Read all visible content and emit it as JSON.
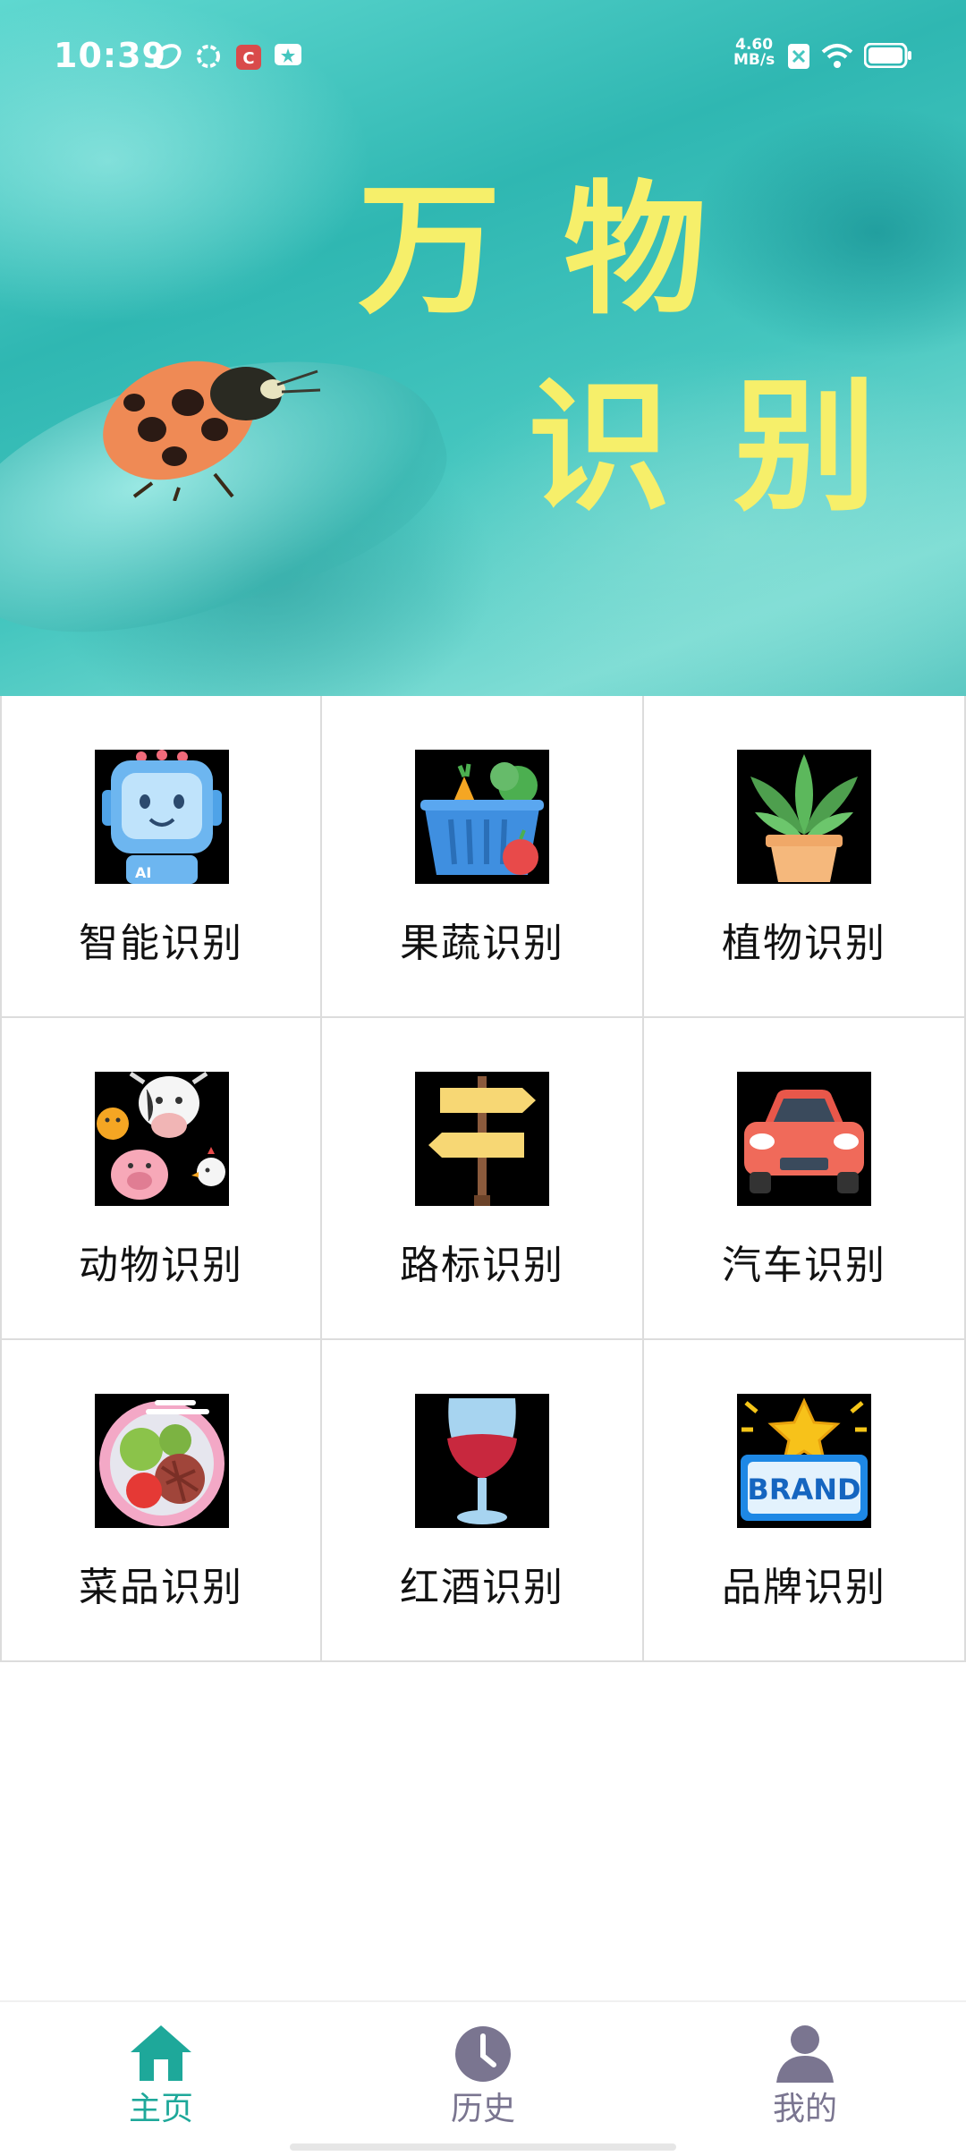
{
  "status_bar": {
    "time": "10:39",
    "net_speed_value": "4.60",
    "net_speed_unit": "MB/s"
  },
  "hero": {
    "title_line1": "万物",
    "title_line2": "识别"
  },
  "grid": {
    "items": [
      {
        "label": "智能识别",
        "icon": "robot-icon"
      },
      {
        "label": "果蔬识别",
        "icon": "vegetable-basket-icon"
      },
      {
        "label": "植物识别",
        "icon": "potted-plant-icon"
      },
      {
        "label": "动物识别",
        "icon": "animals-icon"
      },
      {
        "label": "路标识别",
        "icon": "signpost-icon"
      },
      {
        "label": "汽车识别",
        "icon": "car-icon"
      },
      {
        "label": "菜品识别",
        "icon": "dish-icon"
      },
      {
        "label": "红酒识别",
        "icon": "wine-glass-icon"
      },
      {
        "label": "品牌识别",
        "icon": "brand-icon"
      }
    ]
  },
  "bottom_nav": {
    "home": "主页",
    "history": "历史",
    "mine": "我的"
  },
  "colors": {
    "accent": "#1ea89a",
    "title_yellow": "#f6ef6a",
    "inactive_tab": "#7a7590"
  }
}
